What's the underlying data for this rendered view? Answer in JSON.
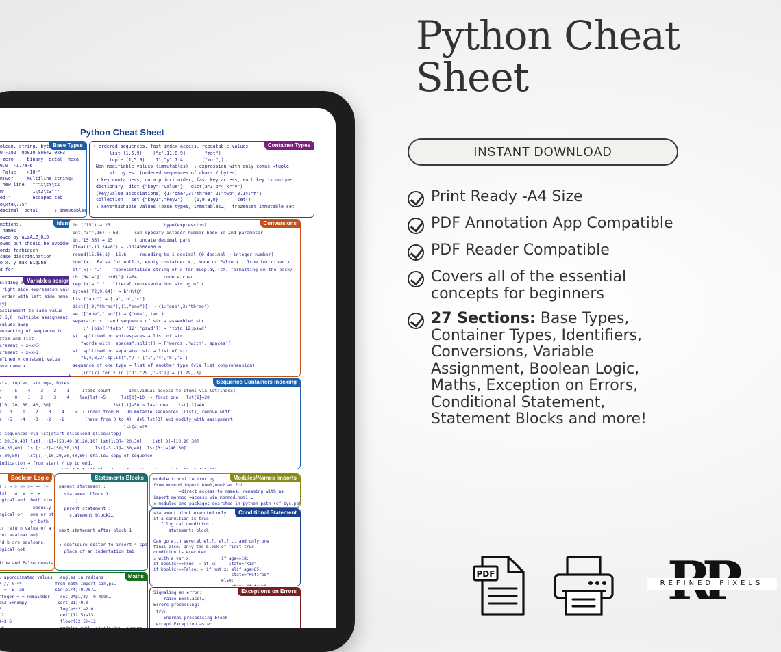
{
  "headline": {
    "line1": "Python Cheat",
    "line2": "Sheet"
  },
  "download_button": "INSTANT DOWNLOAD",
  "features": [
    {
      "bold": "",
      "text": "Print Ready -A4 Size"
    },
    {
      "bold": "",
      "text": "PDF Annotation App Compatible"
    },
    {
      "bold": "",
      "text": "PDF Reader Compatible"
    },
    {
      "bold": "",
      "text": "Covers all of the essential concepts for beginners"
    },
    {
      "bold": "27 Sections:",
      "text": " Base Types, Container Types, Identifiers, Conversions, Variable Assignment, Boolean Logic, Maths, Exception on Errors, Conditional Statement, Statement Blocks and more!"
    }
  ],
  "sheet": {
    "title": "Python Cheat Sheet",
    "sections": {
      "base_types": "Base Types",
      "container_types": "Container Types",
      "identifiers": "Identifiers",
      "conversions": "Conversions",
      "variables_assignment": "Variables assignment",
      "sequence_indexing": "Sequence Containers Indexing",
      "boolean_logic": "Boolean Logic",
      "statements_blocks": "Statements Blocks",
      "modules_imports": "Modules/Names Imports",
      "conditional_statement": "Conditional Statement",
      "maths": "Maths",
      "exceptions": "Exceptions on Errors"
    },
    "snippets": {
      "base_types": "xt, boolean, string, bytes\n 783  0 -192  0b010 0o642 0xF3\n       zero     binary  octal  hexa\n 9.23 0.0  -1.7e-6\n True  False    ×10⁻⁶\n \"One\\nTwo\"     Multiline string:\n caped new line   \"\"\"X\\tY\\tZ\n  'I\\'m'          1\\t2\\t3\"\"\"\n escaped '        escaped tab\n b\"toto\\xfe\\775\"\n  hexadecimal  octal      ⇕ immutables",
      "container_types": "• ordered sequences, fast index access, repeatable values\n      list [1,5,9]    [\"x\",11,8.9]      [\"mot\"]\n     ,tuple (1,5,9)    11,\"y\",7.4       (\"mot\",)\n Non modifiable values (immutables)  ⇕ expression with only comas →tuple\n      str bytes  (ordered sequences of chars / bytes)\n • key containers, no a priori order, fast key access, each key is unique\n dictionary  dict {\"key\":\"value\"}   dict(a=3,b=4,k=\"v\")\n (key/value associations) {1:\"one\",3:\"three\",2:\"two\",3.14:\"π\"}\n collection   set {\"key1\",\"key2\"}    {1,9,3,0}       set()\n ⇕ keys=hashable values (base types, immutables…)  frozenset immutable set",
      "identifiers": "es, functions,\nasses… names\n_ followed by a…zA…Z_0…9\nes allowed but should be avoided\ne keywords forbidden\nUPPER case discrimination\n a toto x7 y_max BigOne\n 8y and for",
      "conversions": "int(\"15\") → 15                    type(expression)\nint(\"3f\",16) → 63      can specify integer number base in 2nd parameter\nint(15.56) → 15        truncate decimal part\nfloat(\"-11.24e8\") → -1124000000.0\nround(15.56,1)→ 15.6     rounding to 1 decimal (0 decimal → integer number)\nbool(x)  False for null x, empty container x , None or False x ; True for other x\nstr(x)→ \"…\"    representation string of x for display (cf. formatting on the back)\nchr(64)→'@'  ord('@')→64          code ↔ char\nrepr(x)→ \"…\"   literal representation string of x\nbytes([72,9,64]) → b'H\\t@'\nlist(\"abc\") → ['a','b','c']\ndict([(3,\"three\"),(1,\"one\")]) → {1:'one',3:'three'}\nset([\"one\",\"two\"]) → {'one','two'}\nseparator str and sequence of str → assembled str\n   ':'.join(['toto','12','pswd']) → 'toto:12:pswd'\nstr splitted on whitespaces → list of str\n   \"words with  spaces\".split() → ['words','with','spaces']\nstr splitted on separator str → list of str\n   \"1,4,8,2\".split(\",\") → ['1','4','8','2']\nsequence of one type → list of another type (via list comprehension)\n   [int(x) for x in ('1','29','-3')] → [1,29,-3]",
      "variables_assignment": "ent ⇔ binding of a name with a value\nion of right side expression value\nent in order with left side names\n 8+sin(y)\n =0   assignment to same value\n 9.2,-7.6,0  multiple assignments\n  a   values swap\n eq   unpacking of sequence in\n eq   item and list\n    increment ⇔ x=x+3\n    decrement ⇔ x=x-2\n ↦ undefined « constant value\n   remove name x",
      "sequence_indexing": "for lists, tuples, strings, bytes…\ne index    -5   -4   -3   -2   -1     Items count       Individual access to items via lst[index]\ne index     0    1    2    3    4    len(lst)→5      lst[0]→10  ⇒ first one   lst[1]→20\n  lst=[10, 20, 30, 40, 50]                        lst[-1]→50 ⇒ last one    lst[-2]→40\ne slice   0    1    2    3    4    5  ⇕ index from 0   On mutable sequences (list), remove with\ne slice  -5   -4   -3   -2   -1        (here from 0 to 4)  del lst[3] and modify with assignment\n                                                      lst[4]=25\n to sub-sequences via lst[start slice:end slice:step]\n-1]→[10,20,30,40] lst[::-1]→[50,40,30,20,10] lst[1:3]→[20,30]    lst[:3]→[10,20,30]\n:-1]→[20,30,40]  lst[::-2]→[50,30,10]      lst[-3:-1]→[30,40]  lst[3:]→[40,50]\n:2]→[10,30,50]   lst[:]→[10,20,30,40,50] shallow copy of sequence\nslice indication → from start / up to end.\nble sequences (list), remove with del lst[3:5] and modify with assignment lst[1:4]=[15,25]",
      "boolean_logic": "arisons : < > <= >= == !=\n results)   ≤  ≥  =  ≠\nd b  logical and  both simulta-\n                  -neously\n b   logical or   one or other\n                  or both\nd and or return value of a or\n shortcut evaluation).\nat a and b are booleans.\n a   logical not\n\n      True and False constants",
      "statements_blocks": "parent statement :\n  statement block 1…\n      ⋮\n  parent statement :\n    statement block2…\n        ⋮\nnext statement after block 1\n\n⇕ configure editor to insert 4 spaces in\n  place of an indentation tab",
      "modules_imports": "module truc⇔file truc.py\nfrom monmod import nom1,nom2 as fct\n          →direct access to names, renaming with as\nimport monmod →access via monmod.nom1 …\n⇕ modules and packages searched in python path (cf sys.path)",
      "conditional_statement": "statement block executed only\nif a condition is true\n  if logical condition :\n      statements block\n\nCan go with several elif, elif... and only one\nfinal else. Only the block of first true\ncondition is executed.\n⇕ with a var x:            if age<=18:\nif bool(x)==True: ⇔ if x:     state=\"Kid\"\nif bool(x)==False: ⇔ if not x: elif age>65:\n                               state=\"Retired\"\n                           else:\n                               state=\"Active\"",
      "maths": "umbers… approximated values   angles in radians\n+ - * / // % **             from math import sin,pi…\n ×  ÷   ÷  ↕  ab            sin(pi/4)→0.707…\n     integer ÷ ÷ remainder    cos(2*pi/3)→-0.4999…\nX python3.5+numpy            sqrt(81)→9.0\n 2→12.6                       log(e**2)→2.0\n .2)→3.2                      ceil(12.5)→13\n 5.7,1)→3.6                   floor(12.5)→12\n 3)→64.0                      modules math, statistics, random,",
      "exceptions": "Signaling an error:\n    raise ExcClass(…)\nErrors processing:\n try:\n    ⇕normal procesising block\n except Exception as e:"
    }
  },
  "bottom": {
    "pdf_label": "PDF",
    "logo_letters": "RP",
    "logo_text": "REFINED PIXELS"
  }
}
